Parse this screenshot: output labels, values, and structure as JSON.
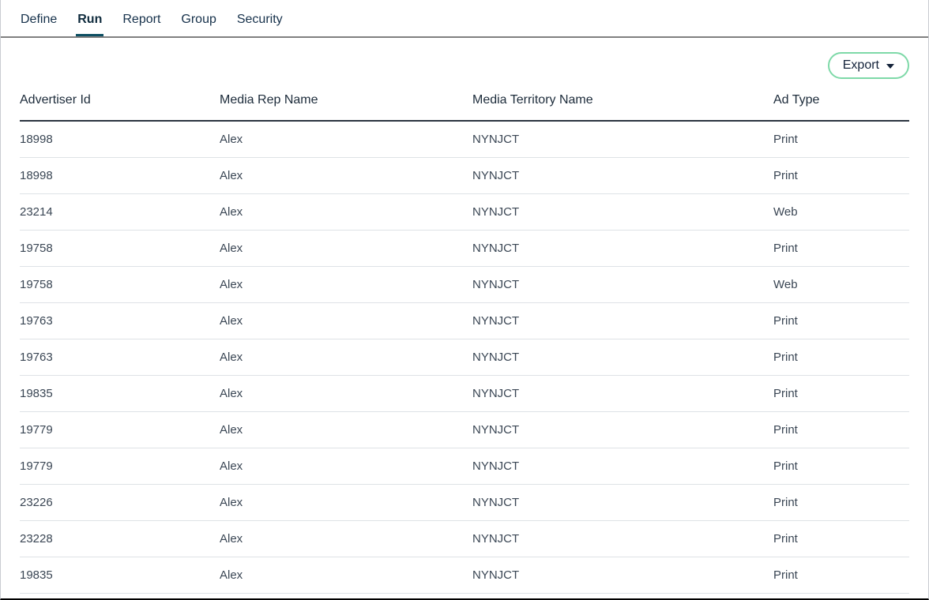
{
  "tabs": [
    {
      "label": "Define",
      "active": false
    },
    {
      "label": "Run",
      "active": true
    },
    {
      "label": "Report",
      "active": false
    },
    {
      "label": "Group",
      "active": false
    },
    {
      "label": "Security",
      "active": false
    }
  ],
  "toolbar": {
    "export_label": "Export",
    "caret_icon": "chevron-down-icon"
  },
  "table": {
    "columns": [
      "Advertiser Id",
      "Media Rep Name",
      "Media Territory Name",
      "Ad Type"
    ],
    "rows": [
      [
        "18998",
        "Alex",
        "NYNJCT",
        "Print"
      ],
      [
        "18998",
        "Alex",
        "NYNJCT",
        "Print"
      ],
      [
        "23214",
        "Alex",
        "NYNJCT",
        "Web"
      ],
      [
        "19758",
        "Alex",
        "NYNJCT",
        "Print"
      ],
      [
        "19758",
        "Alex",
        "NYNJCT",
        "Web"
      ],
      [
        "19763",
        "Alex",
        "NYNJCT",
        "Print"
      ],
      [
        "19763",
        "Alex",
        "NYNJCT",
        "Print"
      ],
      [
        "19835",
        "Alex",
        "NYNJCT",
        "Print"
      ],
      [
        "19779",
        "Alex",
        "NYNJCT",
        "Print"
      ],
      [
        "19779",
        "Alex",
        "NYNJCT",
        "Print"
      ],
      [
        "23226",
        "Alex",
        "NYNJCT",
        "Print"
      ],
      [
        "23228",
        "Alex",
        "NYNJCT",
        "Print"
      ],
      [
        "19835",
        "Alex",
        "NYNJCT",
        "Print"
      ]
    ]
  },
  "colors": {
    "accent_green": "#7ed9a8",
    "active_tab_underline": "#0d4f63",
    "text_primary": "#1c2b3a",
    "row_divider": "#dee2e6",
    "header_divider": "#2b3440"
  }
}
